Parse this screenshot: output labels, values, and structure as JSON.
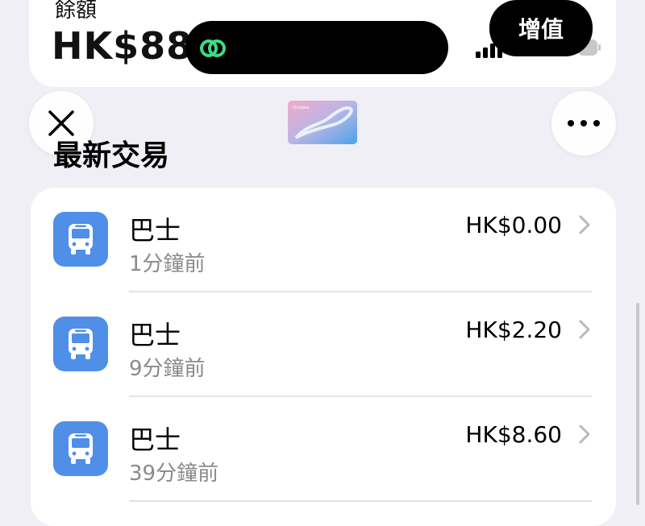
{
  "balance": {
    "label": "餘額",
    "amount": "HK$88"
  },
  "topup_label": "增值",
  "card_name": "Octopus",
  "section_title": "最新交易",
  "transactions": [
    {
      "title": "巴士",
      "time": "1分鐘前",
      "amount": "HK$0.00",
      "icon": "bus-icon"
    },
    {
      "title": "巴士",
      "time": "9分鐘前",
      "amount": "HK$2.20",
      "icon": "bus-icon"
    },
    {
      "title": "巴士",
      "time": "39分鐘前",
      "amount": "HK$8.60",
      "icon": "bus-icon"
    }
  ],
  "colors": {
    "background": "#f0eff5",
    "icon_blue": "#4f8fe8",
    "secondary_text": "#8a8a8e",
    "island_green": "#3ddc84"
  }
}
